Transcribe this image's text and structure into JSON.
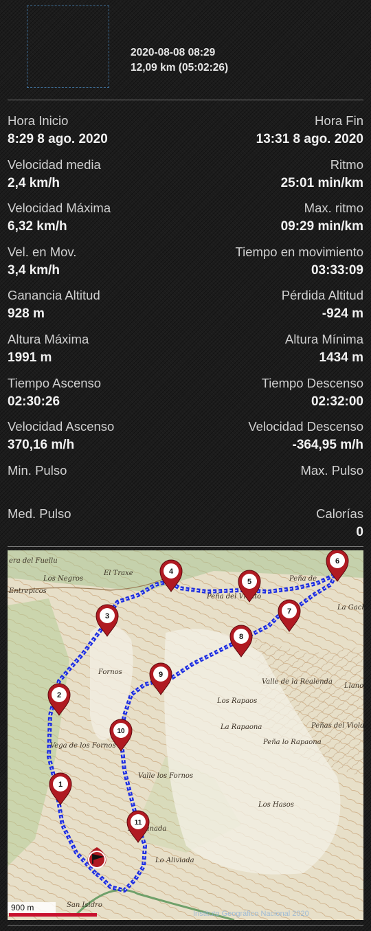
{
  "header": {
    "datetime": "2020-08-08 08:29",
    "distance_duration": "12,09 km (05:02:26)"
  },
  "stats": [
    {
      "left_label": "Hora Inicio",
      "left_value": "8:29 8 ago. 2020",
      "right_label": "Hora Fin",
      "right_value": "13:31 8 ago. 2020"
    },
    {
      "left_label": "Velocidad media",
      "left_value": "2,4 km/h",
      "right_label": "Ritmo",
      "right_value": "25:01 min/km"
    },
    {
      "left_label": "Velocidad Máxima",
      "left_value": "6,32 km/h",
      "right_label": "Max. ritmo",
      "right_value": "09:29 min/km"
    },
    {
      "left_label": "Vel. en Mov.",
      "left_value": "3,4 km/h",
      "right_label": "Tiempo en movimiento",
      "right_value": "03:33:09"
    },
    {
      "left_label": "Ganancia Altitud",
      "left_value": "928 m",
      "right_label": "Pérdida Altitud",
      "right_value": "-924 m"
    },
    {
      "left_label": "Altura Máxima",
      "left_value": "1991 m",
      "right_label": "Altura Mínima",
      "right_value": "1434 m"
    },
    {
      "left_label": "Tiempo Ascenso",
      "left_value": "02:30:26",
      "right_label": "Tiempo Descenso",
      "right_value": "02:32:00"
    },
    {
      "left_label": "Velocidad Ascenso",
      "left_value": "370,16 m/h",
      "right_label": "Velocidad Descenso",
      "right_value": "-364,95 m/h"
    },
    {
      "left_label": "Min. Pulso",
      "left_value": "",
      "right_label": "Max. Pulso",
      "right_value": ""
    },
    {
      "left_label": "Med. Pulso",
      "left_value": "",
      "right_label": "Calorías",
      "right_value": "0"
    }
  ],
  "map": {
    "scale_label": "900 m",
    "attribution": "Instituto Geográfico Nacional 2020",
    "place_names": [
      "era del Fuellu",
      "Los Negros",
      "Entrepicos",
      "El Traxe",
      "Peña de",
      "Peña del Viento",
      "La Gacha",
      "Valle de la Realenda",
      "Los Rapaos",
      "La Rapaona",
      "Peñas del Viola",
      "Peña lo Rapaona",
      "Valle los Fornos",
      "Vega de los Fornos",
      "Fornos",
      "Los Hasos",
      "La Llanada",
      "Lo Aliviada",
      "San Isidro",
      "Llano"
    ],
    "waypoints": [
      "1",
      "2",
      "3",
      "4",
      "5",
      "6",
      "7",
      "8",
      "9",
      "10",
      "11"
    ],
    "colors": {
      "track": "#1f2fe0",
      "marker": "#b01a22",
      "scale_bar": "#c8102e"
    }
  }
}
